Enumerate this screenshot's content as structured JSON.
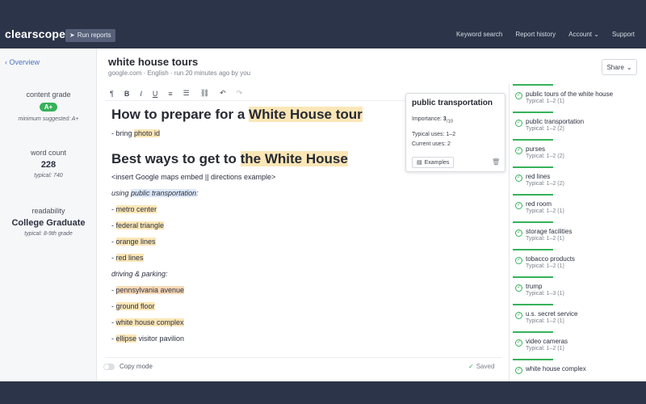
{
  "topbar": {
    "logo": "clearscope",
    "run_reports": "Run reports",
    "nav": [
      "Keyword search",
      "Report history",
      "Account",
      "Support"
    ]
  },
  "left": {
    "overview": "Overview",
    "content_grade_label": "content grade",
    "content_grade": "A+",
    "content_grade_min": "minimum suggested: A+",
    "word_count_label": "word count",
    "word_count": "228",
    "word_count_typical": "typical: 740",
    "readability_label": "readability",
    "readability": "College Graduate",
    "readability_typical": "typical: 8-9th grade"
  },
  "header": {
    "title": "white house tours",
    "subtitle": "google.com · English · run 20 minutes ago by you",
    "share": "Share"
  },
  "toolbar": {
    "items": [
      "¶",
      "B",
      "I",
      "U",
      "≡",
      "☰",
      "⛓",
      "↶",
      "↷"
    ]
  },
  "editor": {
    "h1a_pre": "How to prepare for a ",
    "h1a_hl": "White House tour",
    "l1_pre": "- bring ",
    "l1_hl": "photo id",
    "h1b_pre": "Best ways to get to ",
    "h1b_hl": "the White House",
    "l2": "<insert Google maps embed || directions example>",
    "l3_pre": "using ",
    "l3_hl": "public transportation",
    "l3_post": ":",
    "l4_hl": "metro center",
    "l5_hl": "federal triangle",
    "l6_hl": "orange lines",
    "l7_hl": "red lines",
    "l8": "driving & parking:",
    "l9_hl": "pennsylvania avenue",
    "l10_hl": "ground floor",
    "l11_hl": "white house complex",
    "l12_hl": "ellipse",
    "l12_post": " visitor pavilion",
    "dash": "- "
  },
  "footer": {
    "copy_mode": "Copy mode",
    "saved": "Saved"
  },
  "popup": {
    "title": "public transportation",
    "importance_label": "Importance: ",
    "importance_value": "3",
    "importance_of": "/10",
    "typical_uses": "Typical uses: 1–2",
    "current_uses": "Current uses: 2",
    "examples": "Examples"
  },
  "terms": [
    {
      "name": "public tours of the white house",
      "typical": "Typical: 1–2 (1)"
    },
    {
      "name": "public transportation",
      "typical": "Typical: 1–2 (2)"
    },
    {
      "name": "purses",
      "typical": "Typical: 1–2 (2)"
    },
    {
      "name": "red lines",
      "typical": "Typical: 1–2 (2)"
    },
    {
      "name": "red room",
      "typical": "Typical: 1–2 (1)"
    },
    {
      "name": "storage facilities",
      "typical": "Typical: 1–2 (1)"
    },
    {
      "name": "tobacco products",
      "typical": "Typical: 1–2 (1)"
    },
    {
      "name": "trump",
      "typical": "Typical: 1–3 (1)"
    },
    {
      "name": "u.s. secret service",
      "typical": "Typical: 1–2 (1)"
    },
    {
      "name": "video cameras",
      "typical": "Typical: 1–2 (1)"
    },
    {
      "name": "white house complex",
      "typical": ""
    }
  ],
  "colors": {
    "frame": "#2b3448",
    "accent_green": "#36b25a",
    "highlight": "#fbe6b6",
    "link": "#4a72c4"
  }
}
